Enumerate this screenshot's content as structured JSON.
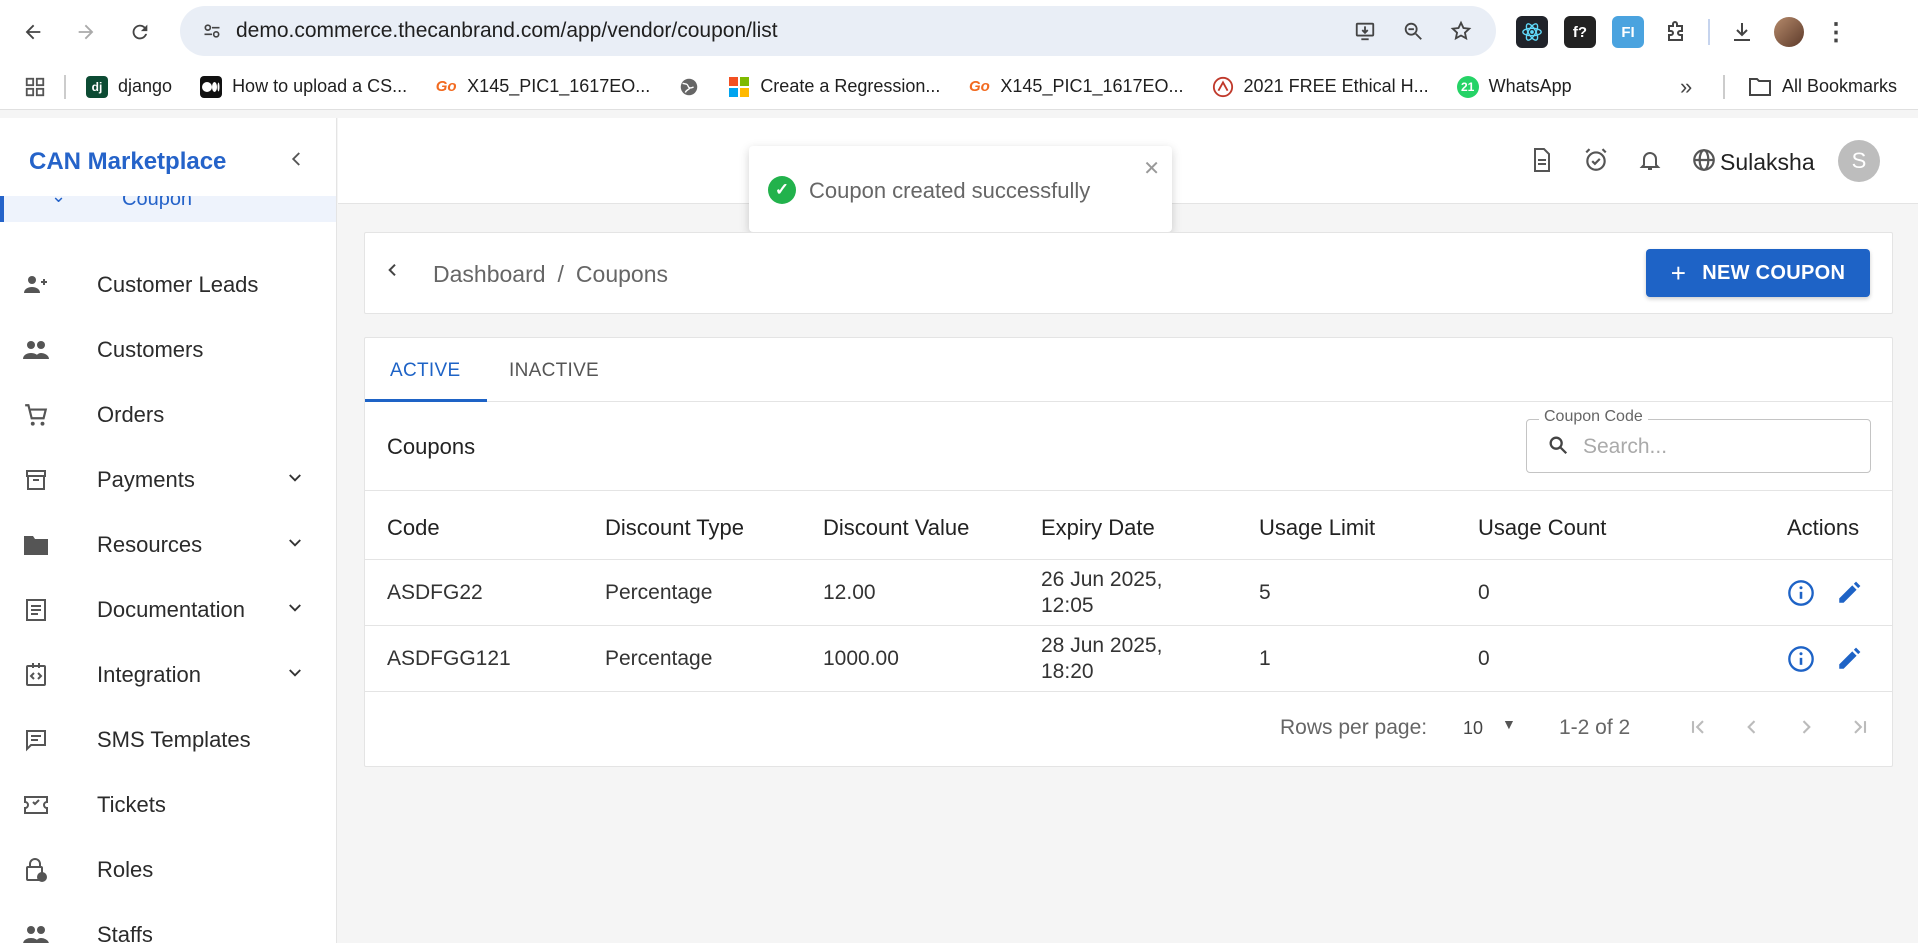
{
  "browser": {
    "url": "demo.commerce.thecanbrand.com/app/vendor/coupon/list",
    "bookmarks": [
      {
        "label": "django",
        "icon": "dj",
        "color": "#0c4b33"
      },
      {
        "label": "How to upload a CS...",
        "icon": "M",
        "color": "#111111"
      },
      {
        "label": "X145_PIC1_1617EO...",
        "icon": "Go",
        "color": "#f26b21"
      },
      {
        "label": "",
        "icon": "globe",
        "color": "#666666"
      },
      {
        "label": "Create a Regression...",
        "icon": "ms",
        "color": "#f25022"
      },
      {
        "label": "X145_PIC1_1617EO...",
        "icon": "Go",
        "color": "#f26b21"
      },
      {
        "label": "2021 FREE Ethical H...",
        "icon": "eh",
        "color": "#c0392b"
      },
      {
        "label": "WhatsApp",
        "icon": "21",
        "color": "#25d366"
      }
    ],
    "all_bookmarks": "All Bookmarks"
  },
  "app": {
    "brand": "CAN Marketplace",
    "selected_nav": "Coupon",
    "nav": [
      {
        "label": "Customer Leads",
        "icon": "person-add-icon",
        "chevron": false
      },
      {
        "label": "Customers",
        "icon": "people-icon",
        "chevron": false
      },
      {
        "label": "Orders",
        "icon": "cart-icon",
        "chevron": false
      },
      {
        "label": "Payments",
        "icon": "archive-icon",
        "chevron": true
      },
      {
        "label": "Resources",
        "icon": "folder-icon",
        "chevron": true
      },
      {
        "label": "Documentation",
        "icon": "document-icon",
        "chevron": true
      },
      {
        "label": "Integration",
        "icon": "integration-icon",
        "chevron": true
      },
      {
        "label": "SMS Templates",
        "icon": "message-icon",
        "chevron": false
      },
      {
        "label": "Tickets",
        "icon": "ticket-icon",
        "chevron": false
      },
      {
        "label": "Roles",
        "icon": "lock-icon",
        "chevron": false
      },
      {
        "label": "Staffs",
        "icon": "people-icon",
        "chevron": false
      }
    ],
    "user": {
      "name": "Sulaksha",
      "initial": "S"
    }
  },
  "toast": {
    "message": "Coupon created successfully"
  },
  "breadcrumb": {
    "root": "Dashboard",
    "sep": "/",
    "current": "Coupons"
  },
  "new_button": "NEW COUPON",
  "tabs": {
    "active": "ACTIVE",
    "inactive": "INACTIVE"
  },
  "section_title": "Coupons",
  "search": {
    "label": "Coupon Code",
    "placeholder": "Search..."
  },
  "table": {
    "headers": [
      "Code",
      "Discount Type",
      "Discount Value",
      "Expiry Date",
      "Usage Limit",
      "Usage Count",
      "Actions"
    ],
    "rows": [
      {
        "code": "ASDFG22",
        "type": "Percentage",
        "value": "12.00",
        "expiry_date": "26 Jun 2025,",
        "expiry_time": "12:05",
        "limit": "5",
        "count": "0"
      },
      {
        "code": "ASDFGG121",
        "type": "Percentage",
        "value": "1000.00",
        "expiry_date": "28 Jun 2025,",
        "expiry_time": "18:20",
        "limit": "1",
        "count": "0"
      }
    ]
  },
  "pagination": {
    "rows_label": "Rows per page:",
    "rows_value": "10",
    "range": "1-2 of 2"
  },
  "colors": {
    "primary": "#1e63c6",
    "success": "#22b24c"
  }
}
